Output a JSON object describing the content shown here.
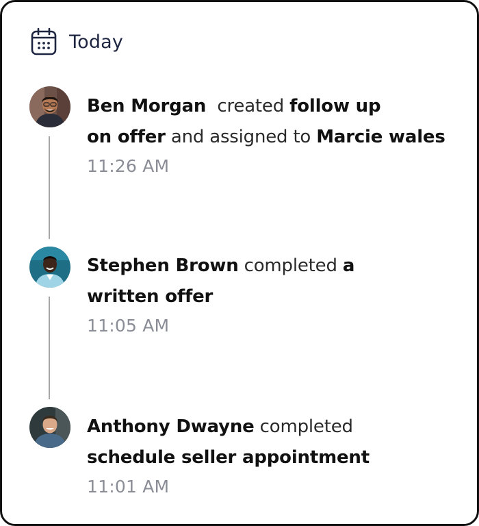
{
  "header": {
    "icon": "calendar-icon",
    "title": "Today"
  },
  "colors": {
    "title": "#1e2540",
    "timestamp": "#8a8d96",
    "line": "#a6a6a6"
  },
  "activities": [
    {
      "actor": "Ben Morgan",
      "avatar": "avatar-ben-morgan",
      "verb": "created",
      "object_line1": "follow up",
      "object_line2": "on offer",
      "connector": "and assigned to",
      "target": "Marcie wales",
      "time": "11:26 AM"
    },
    {
      "actor": "Stephen Brown",
      "avatar": "avatar-stephen-brown",
      "verb": "completed",
      "object_line1": "a",
      "object_line2": "written offer",
      "time": "11:05 AM"
    },
    {
      "actor": "Anthony Dwayne",
      "avatar": "avatar-anthony-dwayne",
      "verb": "completed",
      "object_line2": "schedule seller appointment",
      "time": "11:01 AM"
    }
  ]
}
